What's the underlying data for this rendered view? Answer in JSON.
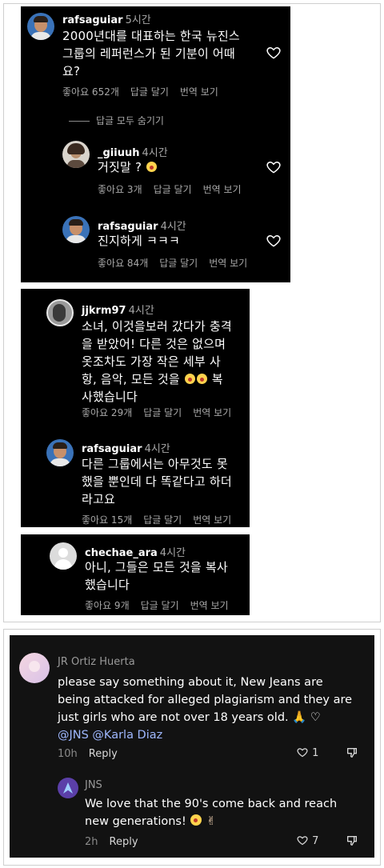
{
  "ig": {
    "thread1": {
      "comment": {
        "username": "rafsaguiar",
        "time": "5시간",
        "lines": [
          "2000년대를 대표하는 한국 뉴진스",
          "그룹의 레퍼런스가 된 기분이 어때",
          "요?"
        ],
        "likes": "좋아요 652개",
        "reply": "답글 달기",
        "translate": "번역 보기"
      },
      "hide_replies": "답글 모두 숨기기",
      "reply1": {
        "username": "_giiuuh",
        "time": "4시간",
        "text": "거짓말 ?",
        "likes": "좋아요 3개",
        "reply": "답글 달기",
        "translate": "번역 보기"
      },
      "reply2": {
        "username": "rafsaguiar",
        "time": "4시간",
        "text": "진지하게 ㅋㅋㅋ",
        "likes": "좋아요 84개",
        "reply": "답글 달기",
        "translate": "번역 보기"
      }
    },
    "thread2": {
      "comment": {
        "username": "jjkrm97",
        "time": "4시간",
        "lines": [
          "소녀, 이것을보러 갔다가 충격",
          "을 받았어! 다른 것은 없으며",
          "옷조차도 가장 작은 세부 사",
          "항, 음악, 모든 것을",
          "복",
          "사했습니다"
        ],
        "likes": "좋아요 29개",
        "reply": "답글 달기",
        "translate": "번역 보기"
      },
      "reply": {
        "username": "rafsaguiar",
        "time": "4시간",
        "lines": [
          "다른 그룹에서는 아무것도 못",
          "했을 뿐인데 다 똑같다고 하더",
          "라고요"
        ],
        "likes": "좋아요 15개",
        "reply": "답글 달기",
        "translate": "번역 보기"
      }
    },
    "thread3": {
      "comment": {
        "username": "chechae_ara",
        "time": "4시간",
        "lines": [
          "아니, 그들은 모든 것을 복사",
          "했습니다"
        ],
        "likes": "좋아요 9개",
        "reply": "답글 달기",
        "translate": "번역 보기"
      }
    }
  },
  "tiktok": {
    "comment": {
      "username": "JR Ortiz Huerta",
      "lines": [
        "please say something about it, New Jeans are",
        "being attacked for alleged plagiarism and they are",
        "just girls who are not over 18 years old."
      ],
      "mentions": "@JNS @Karla Diaz",
      "time": "10h",
      "reply": "Reply",
      "like_count": "1"
    },
    "reply": {
      "username": "JNS",
      "lines": [
        "We love that the 90's come back and reach",
        "new generations!"
      ],
      "time": "2h",
      "reply": "Reply",
      "like_count": "7"
    }
  },
  "colors": {
    "panel_bg": "#000000",
    "tiktok_bg": "#121212",
    "meta": "#a8a8a8",
    "mention": "#9fb8ff"
  }
}
